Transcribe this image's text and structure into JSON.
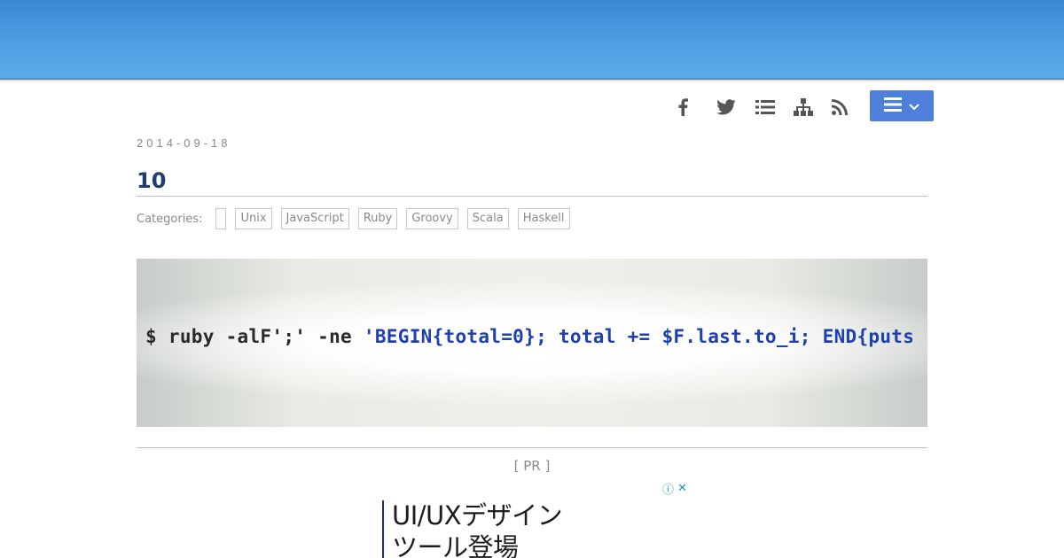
{
  "header": {
    "banner_color": "#4f9ee2"
  },
  "social": [
    {
      "icon": "facebook-icon"
    },
    {
      "icon": "twitter-icon"
    },
    {
      "icon": "list-icon"
    },
    {
      "icon": "sitemap-icon"
    },
    {
      "icon": "rss-icon"
    }
  ],
  "menu_button": {
    "icon": "hamburger-icon",
    "color": "#4d7fdb"
  },
  "post": {
    "date": "2014-09-18",
    "title": "10",
    "categories_label": "Categories:",
    "categories": [
      "Unix",
      "JavaScript",
      "Ruby",
      "Groovy",
      "Scala",
      "Haskell"
    ],
    "eyecatch": {
      "prompt": "$ ruby -alF';' -ne ",
      "code": "'BEGIN{total=0}; total += $F.last.to_i; END{puts"
    }
  },
  "pr": {
    "label": "[ PR ]"
  },
  "ad": {
    "line1": "UI/UXデザイン",
    "line2": "ツール登場",
    "info_icon": "ⓘ",
    "close_icon": "✕"
  }
}
